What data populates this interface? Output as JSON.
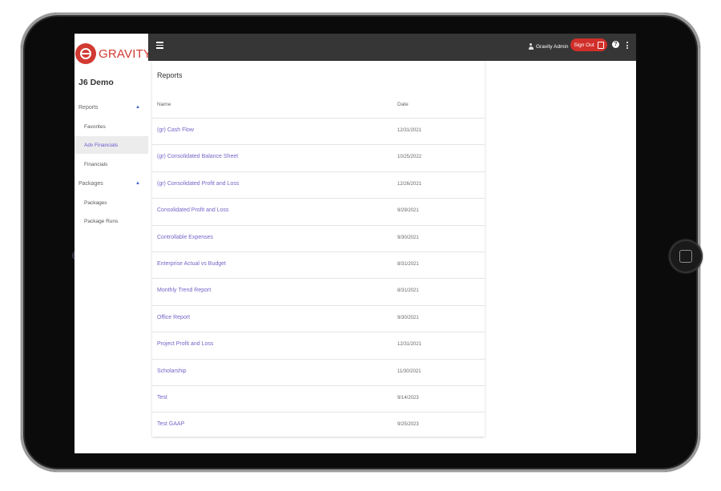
{
  "brand": {
    "name": "GRAVITY",
    "accent": "#d13a32",
    "link_color": "#7466c8"
  },
  "sidebar": {
    "company": "J6 Demo",
    "sections": [
      {
        "label": "Reports",
        "expanded": true,
        "items": [
          {
            "label": "Favorites",
            "active": false
          },
          {
            "label": "Adv Financials",
            "active": true
          },
          {
            "label": "Financials",
            "active": false
          }
        ]
      },
      {
        "label": "Packages",
        "expanded": true,
        "items": [
          {
            "label": "Packages",
            "active": false
          },
          {
            "label": "Package Runs",
            "active": false
          }
        ]
      }
    ]
  },
  "header": {
    "menu_icon": "hamburger-icon",
    "user": "Gravity Admin",
    "signout_label": "Sign Out",
    "help_label": "?",
    "more_icon": "vertical-dots-icon"
  },
  "reports": {
    "title": "Reports",
    "columns": {
      "name": "Name",
      "date": "Date"
    },
    "rows": [
      {
        "name": "(gr) Cash Flow",
        "date": "12/31/2021"
      },
      {
        "name": "(gr) Consolidated Balance Sheet",
        "date": "10/25/2022"
      },
      {
        "name": "(gr) Consolidated Profit and Loss",
        "date": "12/26/2021"
      },
      {
        "name": "Consolidated Profit and Loss",
        "date": "9/29/2021"
      },
      {
        "name": "Controllable Expenses",
        "date": "9/30/2021"
      },
      {
        "name": "Enterprise Actual vs Budget",
        "date": "8/31/2021"
      },
      {
        "name": "Monthly Trend Report",
        "date": "8/31/2021"
      },
      {
        "name": "Office Report",
        "date": "9/30/2021"
      },
      {
        "name": "Project Profit and Loss",
        "date": "12/31/2021"
      },
      {
        "name": "Scholarship",
        "date": "11/30/2021"
      },
      {
        "name": "Test",
        "date": "9/14/2023"
      },
      {
        "name": "Test GAAP",
        "date": "9/25/2023"
      }
    ]
  }
}
